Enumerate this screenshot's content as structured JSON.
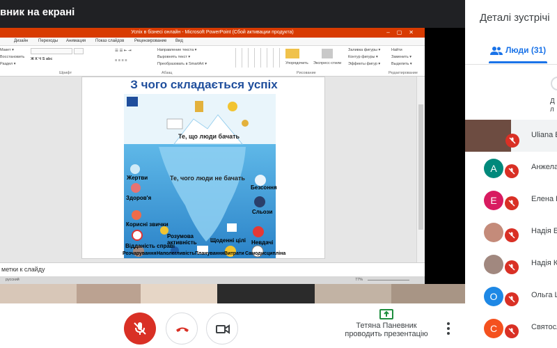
{
  "topbar": {
    "title": "вник на екрані"
  },
  "ppt": {
    "window_title": "Успіх в бізнесі онлайн - Microsoft PowerPoint (Сбой активации продукта)",
    "tabs": [
      "Дизайн",
      "Переходы",
      "Анимация",
      "Показ слайдов",
      "Рецензирование",
      "Вид"
    ],
    "ribbon": {
      "clipboard": [
        "Макет ▾",
        "Восстановить",
        "Раздел ▾"
      ],
      "text_direction": "Направление текста ▾",
      "align_text": "Выровнять текст ▾",
      "smartart": "Преобразовать в SmartArt ▾",
      "arrange": "Упорядочить",
      "quick_styles": "Экспресс-стили",
      "shape_fill": "Заливка фигуры ▾",
      "shape_outline": "Контур фигуры ▾",
      "shape_effects": "Эффекты фигур ▾",
      "find": "Найти",
      "replace": "Заменить ▾",
      "select": "Выделить ▾",
      "group_font": "Шрифт",
      "group_paragraph": "Абзац",
      "group_drawing": "Рисование",
      "group_editing": "Редактирование"
    },
    "notes": "метки к слайду",
    "status_lang": "русский",
    "zoom": "77%"
  },
  "slide": {
    "title": "З чого складається успіх",
    "visible_text": "Те, що люди бачать",
    "hidden_text": "Те, чого люди не бачать",
    "labels": {
      "zhertvy": "Жертви",
      "zdorovia": "Здоров'я",
      "korysni": "Корисні звички",
      "vidanist": "Відданість справі",
      "rozumova_l1": "Розумова",
      "rozumova_l2": "активність",
      "shchodenni": "Щоденні цілі",
      "nevdachi": "Невдачі",
      "bezsonnia": "Безсоння",
      "slozy": "Сльози",
      "rozcharuvannia": "Розчарування",
      "napolehlyvist": "Наполегливість",
      "planuvannia": "Планування",
      "vytraty": "Витрати",
      "samodystsyplina": "Самодисципліна"
    }
  },
  "presenting": {
    "line1": "Тетяна Паневник",
    "line2": "проводить презентацію"
  },
  "panel": {
    "title": "Деталі зустрічі",
    "tab_label": "Люди (31)",
    "participants": [
      {
        "name": "Uliana В",
        "type": "photo",
        "color": "#6d4c41"
      },
      {
        "initial": "А",
        "name": "Анжела",
        "type": "letter",
        "color": "#00897b"
      },
      {
        "initial": "Е",
        "name": "Елена П",
        "type": "letter",
        "color": "#d81b60"
      },
      {
        "name": "Надія Б",
        "type": "photo",
        "color": "#c48b7a"
      },
      {
        "name": "Надія К",
        "type": "photo",
        "color": "#a1887f"
      },
      {
        "initial": "О",
        "name": "Ольга Ш",
        "type": "letter",
        "color": "#1e88e5"
      },
      {
        "initial": "С",
        "name": "Святосл",
        "type": "letter",
        "color": "#f4511e"
      }
    ],
    "cut_initial": "Д",
    "cut_sub": "л"
  },
  "colors": {
    "ppt_title": "#d83b01",
    "mic_muted": "#d93025",
    "accent": "#1a73e8",
    "slide_title": "#1f4e9c"
  }
}
